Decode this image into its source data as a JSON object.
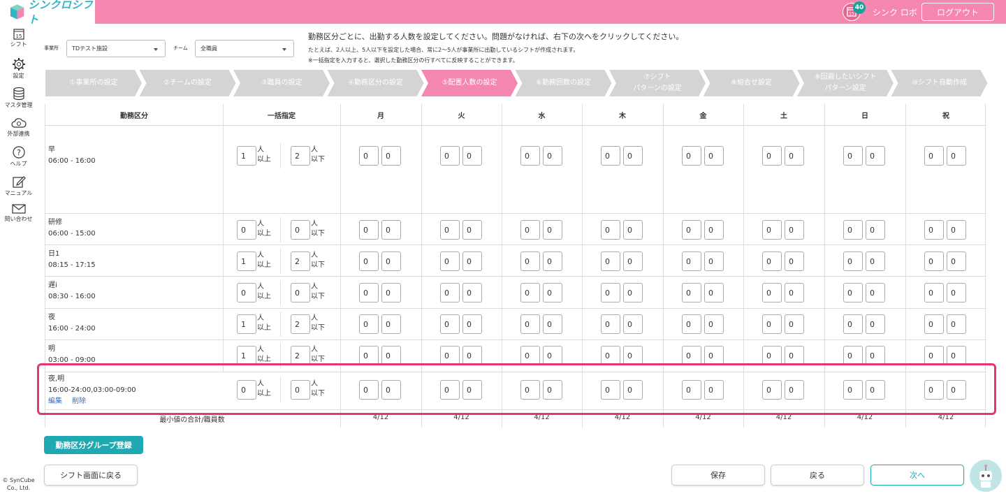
{
  "app": {
    "name": "シンクロシフト",
    "notification_count": "40",
    "calendar_day": "15",
    "user": "シンク ロボ",
    "logout": "ログアウト",
    "brand_pink": "#f486b0",
    "brand_teal": "#1fa9b3"
  },
  "sidebar": {
    "items": [
      {
        "label": "シフト",
        "icon": "calendar-icon"
      },
      {
        "label": "設定",
        "icon": "gear-icon"
      },
      {
        "label": "マスタ管理",
        "icon": "database-icon"
      },
      {
        "label": "外部連携",
        "icon": "cloud-sync-icon"
      },
      {
        "label": "ヘルプ",
        "icon": "help-icon"
      },
      {
        "label": "マニュアル",
        "icon": "edit-icon"
      },
      {
        "label": "問い合わせ",
        "icon": "mail-icon"
      }
    ],
    "copyright_1": "© SynCube",
    "copyright_2": "Co., Ltd."
  },
  "filters": {
    "office_label": "事業所",
    "office_value": "TDテスト施設",
    "team_label": "チーム",
    "team_value": "全職員"
  },
  "instructions": {
    "line1": "勤務区分ごとに、出勤する人数を設定してください。問題がなければ、右下の次へをクリックしてください。",
    "line2": "たとえば、2人以上、5人以下を設定した場合、常に2〜5人が事業所に出勤しているシフトが作成されます。",
    "line3": "※一括指定を入力すると、選択した勤務区分の行すべてに反映することができます。"
  },
  "steps": [
    {
      "label": "①事業所の設定"
    },
    {
      "label": "②チームの設定"
    },
    {
      "label": "③職員の設定"
    },
    {
      "label": "④勤務区分の設定"
    },
    {
      "label": "⑤配置人数の設定",
      "active": true
    },
    {
      "label": "⑥勤務回数の設定"
    },
    {
      "label": "⑦シフト\nパターンの設定"
    },
    {
      "label": "⑧組合せ設定"
    },
    {
      "label": "⑨回避したいシフト\nパターン設定"
    },
    {
      "label": "⑩シフト自動作成"
    }
  ],
  "table": {
    "headers": {
      "shift": "勤務区分",
      "bulk": "一括指定",
      "days": [
        "月",
        "火",
        "水",
        "木",
        "金",
        "土",
        "日",
        "祝"
      ]
    },
    "unit_min": "人\n以上",
    "unit_max": "人\n以下",
    "rows": [
      {
        "name": "早",
        "time": "06:00 - 16:00",
        "bulk_min": "1",
        "bulk_max": "2"
      },
      {
        "name": "研修",
        "time": "06:00 - 15:00",
        "bulk_min": "0",
        "bulk_max": "0"
      },
      {
        "name": "日1",
        "time": "08:15 - 17:15",
        "bulk_min": "1",
        "bulk_max": "2"
      },
      {
        "name": "遅i",
        "time": "08:30 - 16:00",
        "bulk_min": "0",
        "bulk_max": "0"
      },
      {
        "name": "夜",
        "time": "16:00 - 24:00",
        "bulk_min": "1",
        "bulk_max": "2"
      },
      {
        "name": "明",
        "time": "03:00 - 09:00",
        "bulk_min": "1",
        "bulk_max": "2"
      },
      {
        "name": "夜,明",
        "time": "16:00-24:00,03:00-09:00",
        "bulk_min": "0",
        "bulk_max": "0",
        "edit": "編集",
        "delete": "削除"
      }
    ],
    "day_value": "0",
    "summary_label": "最小値の合計/職員数",
    "summary_value": "4/12"
  },
  "buttons": {
    "group_register": "勤務区分グループ登録",
    "back_to_shift": "シフト画面に戻る",
    "save": "保存",
    "back": "戻る",
    "next": "次へ"
  }
}
